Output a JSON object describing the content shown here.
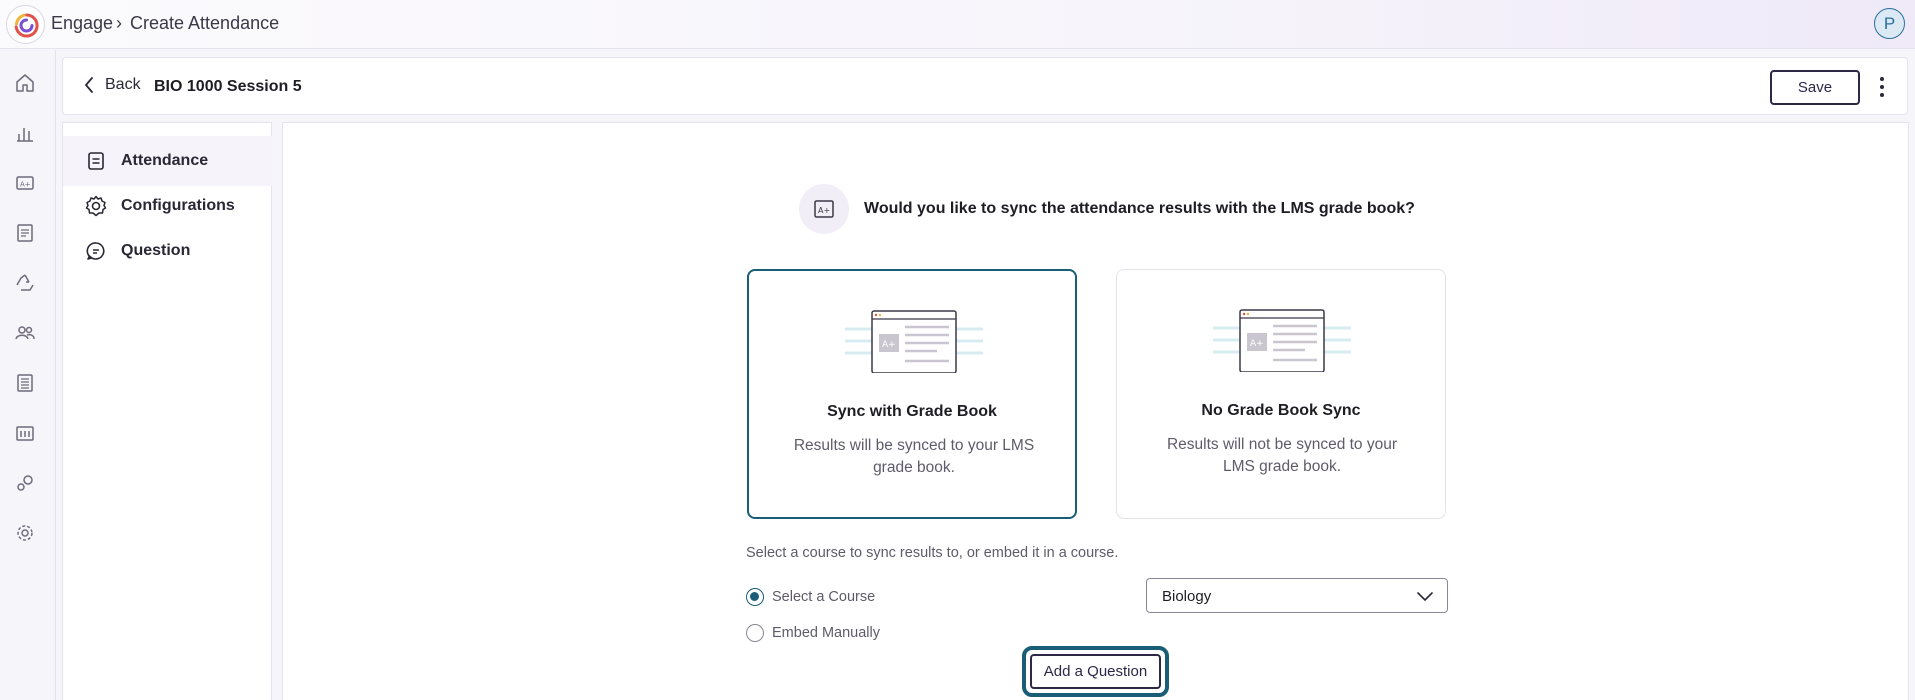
{
  "topbar": {
    "app_name": "Engage",
    "separator": "›",
    "page_title": "Create Attendance",
    "avatar_initial": "P"
  },
  "rail": {
    "icons": [
      "home-icon",
      "analytics-icon",
      "grade-icon",
      "document-icon",
      "recycle-icon",
      "people-icon",
      "list-icon",
      "library-icon",
      "integrations-icon",
      "settings-icon"
    ]
  },
  "header": {
    "back_label": "Back",
    "session_title": "BIO 1000 Session 5",
    "save_label": "Save"
  },
  "side_nav": {
    "items": [
      {
        "label": "Attendance",
        "icon": "document-icon",
        "active": true
      },
      {
        "label": "Configurations",
        "icon": "gear-icon",
        "active": false
      },
      {
        "label": "Question",
        "icon": "chat-icon",
        "active": false
      }
    ]
  },
  "main": {
    "question": "Would you like to sync the attendance results with the LMS grade book?",
    "options": [
      {
        "title": "Sync with Grade Book",
        "description": "Results will be synced to your LMS grade book.",
        "selected": true
      },
      {
        "title": "No Grade Book Sync",
        "description": "Results will not be synced to your LMS grade book.",
        "selected": false
      }
    ],
    "sync_hint": "Select a course to sync results to, or embed it in a course.",
    "radios": [
      {
        "label": "Select a Course",
        "checked": true
      },
      {
        "label": "Embed Manually",
        "checked": false
      }
    ],
    "course_select": {
      "value": "Biology"
    },
    "add_question_label": "Add a Question"
  },
  "colors": {
    "accent": "#1a5d76",
    "primary_text": "#1f1d24",
    "muted_text": "#5f5b69",
    "button_border": "#2d2748"
  }
}
